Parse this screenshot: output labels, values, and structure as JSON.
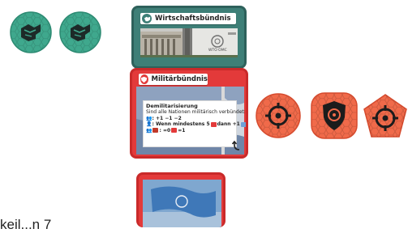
{
  "cards": {
    "economic": {
      "title": "Wirtschaftsbündnis",
      "plaque_text": "WTO OMC"
    },
    "military": {
      "title": "Militärbündnis",
      "text_title": "Demilitarisierung",
      "text_intro": "Sind alle Nationen militärisch verbündet:",
      "line1": ": +1 −1 −2",
      "line2a": ": Wenn mindestens 5",
      "line2b": "dann +1",
      "line3a": ": =0",
      "line3b": "=1"
    }
  },
  "footer_label": "keil...n 7",
  "colors": {
    "teal": "#3e7f77",
    "red": "#e33a3a",
    "orange": "#f06a4a"
  },
  "icons": {
    "teal_tokens": [
      "handshake-icon",
      "handshake-icon"
    ],
    "red_tokens": [
      "crosshair-icon",
      "shield-crosshair-icon",
      "crosshair-icon"
    ]
  }
}
